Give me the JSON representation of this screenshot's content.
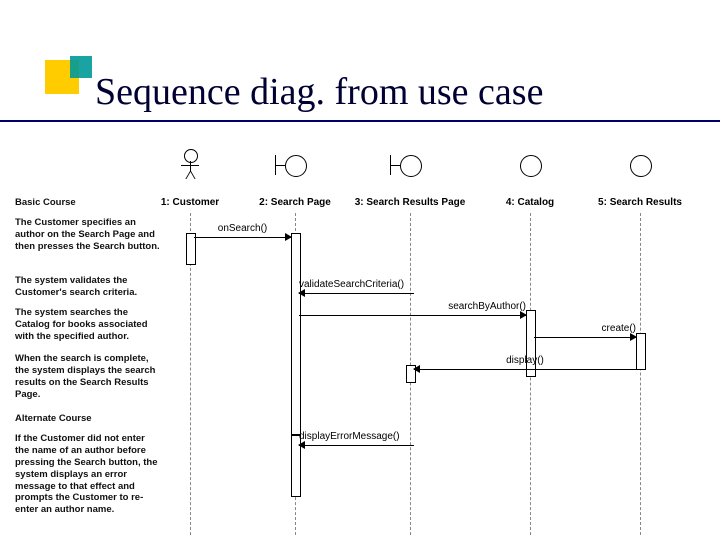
{
  "title": "Sequence diag. from use case",
  "lifelines": {
    "l1": {
      "label": "1: Customer"
    },
    "l2": {
      "label": "2: Search Page"
    },
    "l3": {
      "label": "3: Search Results Page"
    },
    "l4": {
      "label": "4: Catalog"
    },
    "l5": {
      "label": "5: Search Results"
    }
  },
  "messages": {
    "m1": {
      "label": "onSearch()"
    },
    "m2": {
      "label": "validateSearchCriteria()"
    },
    "m3": {
      "label": "searchByAuthor()"
    },
    "m4": {
      "label": "create()"
    },
    "m5": {
      "label": "display()"
    },
    "m6": {
      "label": "displayErrorMessage()"
    }
  },
  "narration": {
    "basic": "Basic Course",
    "n1": "The Customer specifies an author on the Search Page and then presses the Search button.",
    "n2": "The system validates the Customer's search criteria.",
    "n3": "The system searches the Catalog for books associated with the specified author.",
    "n4": "When the search is complete, the system displays the search results on the Search Results Page.",
    "alt": "Alternate Course",
    "n5": "If the Customer did not enter the name of an author before pressing the Search button, the system displays an error message to that effect and prompts the Customer to re-enter an author name."
  }
}
